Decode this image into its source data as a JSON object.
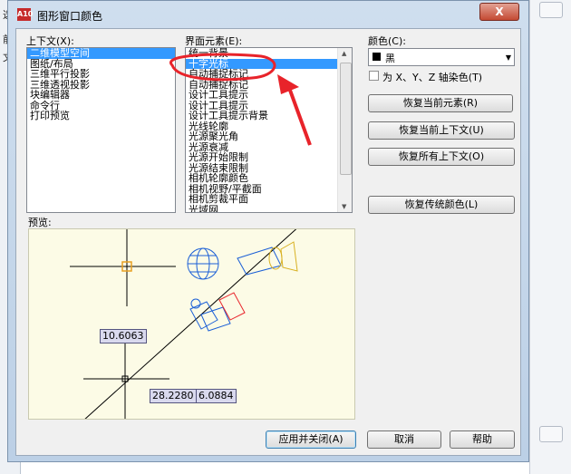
{
  "background": {
    "left_fragments": [
      "选",
      "前",
      "文"
    ]
  },
  "dialog": {
    "app_icon_text": "A10",
    "title": "图形窗口颜色",
    "close_symbol": "X"
  },
  "context": {
    "label": "上下文(X):",
    "items": [
      "二维模型空间",
      "图纸/布局",
      "三维平行投影",
      "三维透视投影",
      "块编辑器",
      "命令行",
      "打印预览"
    ],
    "selected_index": 0
  },
  "elements": {
    "label": "界面元素(E):",
    "items": [
      "统一背景",
      "十字光标",
      "自动捕捉标记",
      "自动捕捉标记",
      "设计工具提示",
      "设计工具提示",
      "设计工具提示背景",
      "光线轮廓",
      "光源聚光角",
      "光源衰减",
      "光源开始限制",
      "光源结束限制",
      "相机轮廓颜色",
      "相机视野/平截面",
      "相机剪裁平面",
      "光域网"
    ],
    "selected_index": 1
  },
  "color": {
    "label": "颜色(C):",
    "value": "黑",
    "swatch": "#000000",
    "tint_label": "为 X、Y、Z 轴染色(T)",
    "tint_checked": false
  },
  "actions": {
    "restore_element": "恢复当前元素(R)",
    "restore_context": "恢复当前上下文(U)",
    "restore_all": "恢复所有上下文(O)",
    "restore_classic": "恢复传统颜色(L)"
  },
  "preview": {
    "label": "预览:",
    "dim1": "10.6063",
    "dim2": "28.2280",
    "dim3": "6.0884"
  },
  "footer": {
    "apply_close": "应用并关闭(A)",
    "cancel": "取消",
    "help": "帮助"
  },
  "colors": {
    "selection": "#3399ff",
    "annotation": "#e8232a"
  }
}
